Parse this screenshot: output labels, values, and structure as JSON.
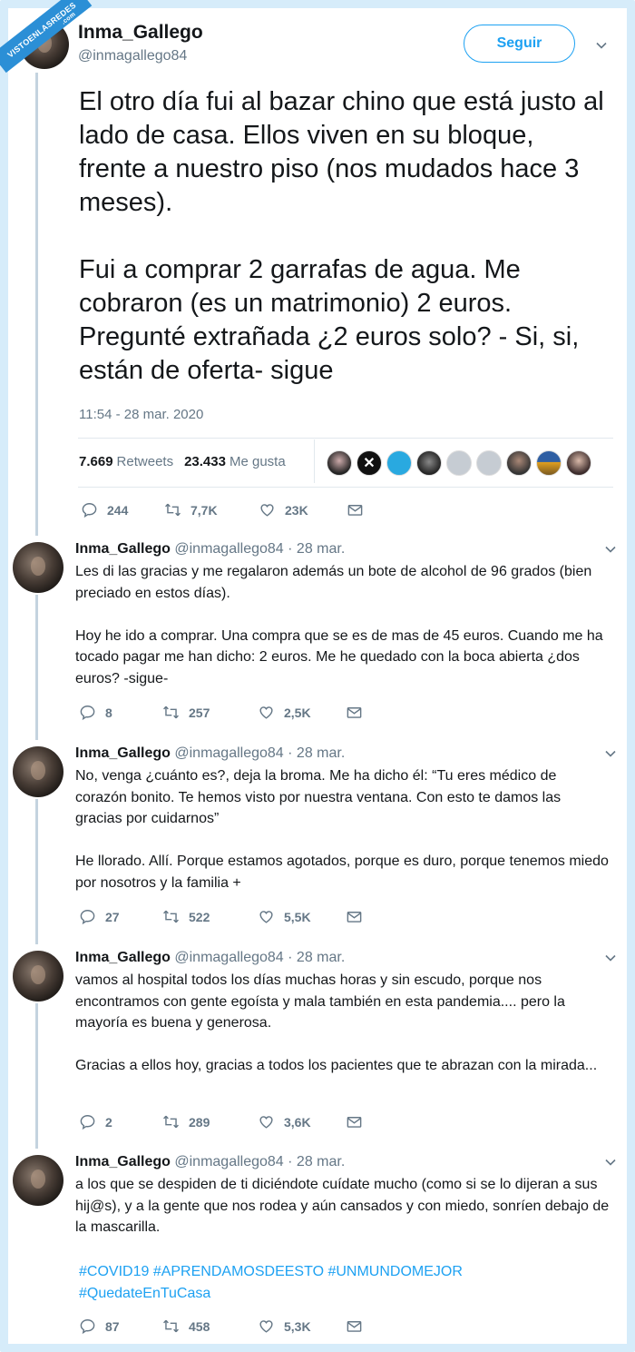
{
  "watermark": {
    "text": "VISTOENLASREDES",
    "sub": ".com"
  },
  "colors": {
    "accent": "#1da1f2",
    "muted": "#657786",
    "frame": "#d6ecfa",
    "text": "#14171a"
  },
  "main_tweet": {
    "name": "Inma_Gallego",
    "handle": "@inmagallego84",
    "follow_label": "Seguir",
    "text": "El otro día fui al bazar chino que está justo al lado de casa. Ellos viven en su bloque, frente a nuestro piso (nos mudados hace 3 meses).\n\nFui a comprar 2 garrafas de agua. Me cobraron (es un matrimonio) 2 euros. Pregunté extrañada ¿2 euros solo? - Si, si, están de oferta- sigue",
    "timestamp": "11:54 - 28 mar. 2020",
    "retweets_count": "7.669",
    "retweets_label": "Retweets",
    "likes_count": "23.433",
    "likes_label": "Me gusta",
    "actions": {
      "replies": "244",
      "retweets": "7,7K",
      "likes": "23K"
    }
  },
  "replies": [
    {
      "name": "Inma_Gallego",
      "handle": "@inmagallego84",
      "date": "· 28 mar.",
      "text": "Les di las gracias y me regalaron además un bote de alcohol de 96 grados (bien preciado en estos días).\n\nHoy he ido a comprar. Una compra que se es de mas de 45 euros. Cuando me ha tocado pagar me han dicho: 2 euros. Me he quedado con la boca abierta ¿dos euros? -sigue-",
      "actions": {
        "replies": "8",
        "retweets": "257",
        "likes": "2,5K"
      }
    },
    {
      "name": "Inma_Gallego",
      "handle": "@inmagallego84",
      "date": "· 28 mar.",
      "text": "No, venga ¿cuánto es?, deja la broma. Me ha dicho él: “Tu eres médico de corazón bonito. Te hemos visto por nuestra ventana. Con esto te damos las gracias por cuidarnos”\n\nHe llorado. Allí. Porque estamos agotados, porque es duro, porque tenemos miedo por nosotros y la familia +",
      "actions": {
        "replies": "27",
        "retweets": "522",
        "likes": "5,5K"
      }
    },
    {
      "name": "Inma_Gallego",
      "handle": "@inmagallego84",
      "date": "· 28 mar.",
      "text": "vamos al hospital todos los días muchas horas y sin escudo, porque nos encontramos con gente egoísta y mala también en esta pandemia.... pero la mayoría es buena y generosa.\n\nGracias a ellos hoy, gracias a todos los pacientes que te abrazan con la mirada...",
      "actions": {
        "replies": "2",
        "retweets": "289",
        "likes": "3,6K"
      }
    },
    {
      "name": "Inma_Gallego",
      "handle": "@inmagallego84",
      "date": "· 28 mar.",
      "text": "a los que se despiden de ti diciéndote cuídate mucho (como si se lo dijeran a sus hij@s), y a la gente que nos rodea y aún cansados y con miedo, sonríen debajo de la mascarilla.",
      "hashtags": "#COVID19 #APRENDAMOSDEESTO #UNMUNDOMEJOR #QuedateEnTuCasa",
      "actions": {
        "replies": "87",
        "retweets": "458",
        "likes": "5,3K"
      }
    }
  ]
}
